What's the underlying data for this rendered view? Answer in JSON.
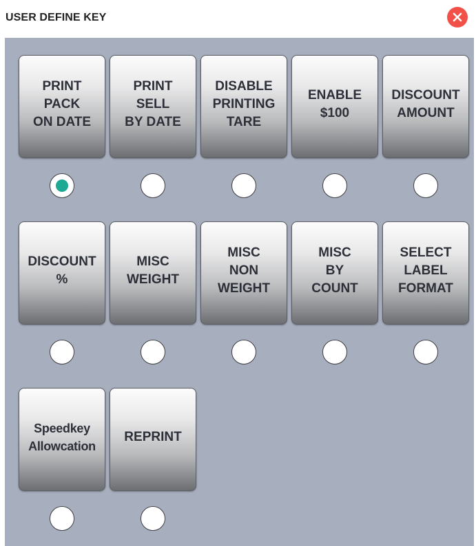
{
  "dialog": {
    "title": "USER DEFINE KEY",
    "close_icon": "close-icon",
    "accent_color": "#1fa894",
    "close_color": "#f2514a"
  },
  "keys": [
    {
      "label": "PRINT\nPACK\nON DATE",
      "selected": true
    },
    {
      "label": "PRINT\nSELL\nBY DATE",
      "selected": false
    },
    {
      "label": "DISABLE\nPRINTING\nTARE",
      "selected": false
    },
    {
      "label": "ENABLE\n$100",
      "selected": false
    },
    {
      "label": "DISCOUNT\nAMOUNT",
      "selected": false
    },
    {
      "label": "DISCOUNT\n%",
      "selected": false
    },
    {
      "label": "MISC\nWEIGHT",
      "selected": false
    },
    {
      "label": "MISC\nNON\nWEIGHT",
      "selected": false
    },
    {
      "label": "MISC\nBY\nCOUNT",
      "selected": false
    },
    {
      "label": "SELECT\nLABEL\nFORMAT",
      "selected": false
    },
    {
      "label": "Speedkey\nAllowcation",
      "selected": false
    },
    {
      "label": "REPRINT",
      "selected": false
    }
  ]
}
